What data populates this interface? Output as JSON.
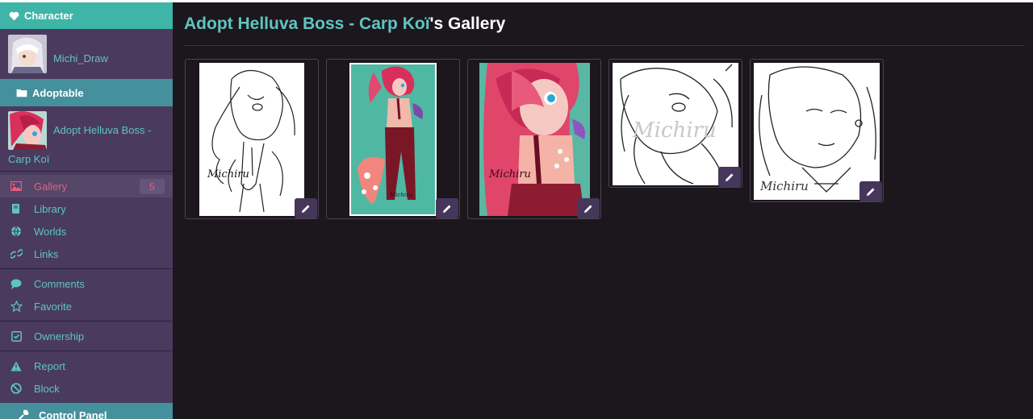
{
  "sidebar": {
    "character_header": "Character",
    "user_name": "Michi_Draw",
    "adoptable_header": "Adoptable",
    "adoptable_name_line1": "Adopt Helluva Boss -",
    "adoptable_name_line2": "Carp Koï",
    "nav_group1": [
      {
        "label": "Gallery",
        "icon": "image-icon",
        "badge": "5",
        "active": true
      },
      {
        "label": "Library",
        "icon": "book-icon"
      },
      {
        "label": "Worlds",
        "icon": "globe-icon"
      },
      {
        "label": "Links",
        "icon": "link-icon"
      }
    ],
    "nav_group2": [
      {
        "label": "Comments",
        "icon": "comment-icon"
      },
      {
        "label": "Favorite",
        "icon": "star-icon"
      }
    ],
    "nav_group3": [
      {
        "label": "Ownership",
        "icon": "checkbox-icon"
      }
    ],
    "nav_group4": [
      {
        "label": "Report",
        "icon": "warning-icon"
      },
      {
        "label": "Block",
        "icon": "ban-icon"
      }
    ],
    "control_panel_header": "Control Panel"
  },
  "main": {
    "title_name": "Adopt Helluva Boss - Carp Koï",
    "title_suffix": "'s Gallery",
    "gallery": [
      {
        "style": "sketch",
        "signature": "Michiru"
      },
      {
        "style": "colored-teal",
        "signature": "Michiru"
      },
      {
        "style": "colored-closeup",
        "signature": "Michiru"
      },
      {
        "style": "sketch-headshot",
        "signature": "Michiru"
      },
      {
        "style": "sketch-headshot",
        "signature": "Michiru"
      }
    ]
  },
  "colors": {
    "accent_teal": "#5ec5c0",
    "header_teal": "#3fb5a8",
    "sidebar_purple": "#4a3a5e",
    "active_pink": "#e75d7f",
    "background": "#1c161d"
  }
}
